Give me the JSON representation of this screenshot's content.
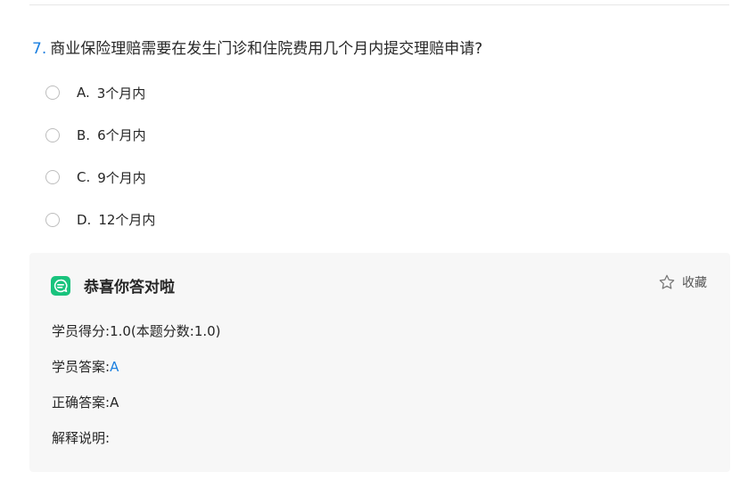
{
  "question": {
    "number": "7.",
    "text": "商业保险理赔需要在发生门诊和住院费用几个月内提交理赔申请?"
  },
  "options": [
    {
      "letter": "A.",
      "text": "3个月内"
    },
    {
      "letter": "B.",
      "text": "6个月内"
    },
    {
      "letter": "C.",
      "text": "9个月内"
    },
    {
      "letter": "D.",
      "text": "12个月内"
    }
  ],
  "result": {
    "title": "恭喜你答对啦",
    "favorite_label": "收藏",
    "score_label": "学员得分:",
    "score_value": "1.0(本题分数:1.0)",
    "student_answer_label": "学员答案:",
    "student_answer_value": "A",
    "correct_answer_label": "正确答案:",
    "correct_answer_value": "A",
    "explanation_label": "解释说明:"
  },
  "colors": {
    "accent_blue": "#1a7fe0",
    "success_green": "#19c37d",
    "panel_bg": "#f7f7f7"
  },
  "icons": {
    "result_icon": "chat-bubble-icon",
    "favorite_icon": "star-outline-icon"
  }
}
